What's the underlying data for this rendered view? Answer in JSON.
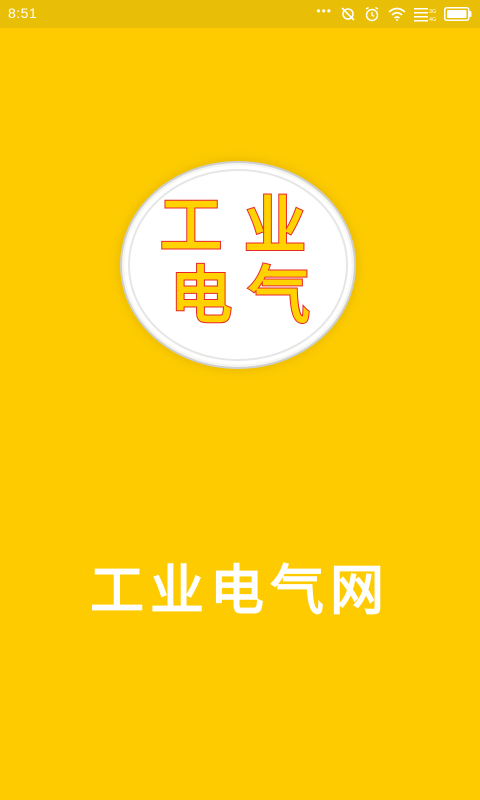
{
  "status_bar": {
    "time": "8:51",
    "icons": [
      "more-dots-icon",
      "data-sync-icon",
      "alarm-icon",
      "wifi-icon",
      "signal-icon",
      "battery-icon"
    ],
    "network_labels": [
      "3G",
      "4G"
    ]
  },
  "logo": {
    "characters": [
      "工",
      "业",
      "电",
      "气"
    ]
  },
  "app_name": "工业电气网",
  "colors": {
    "background": "#FDCB00",
    "status_bar": "#E8BE07",
    "logo_fill": "#FFD200",
    "logo_stroke": "#E8262B",
    "app_name_text": "#FFFFFF"
  }
}
